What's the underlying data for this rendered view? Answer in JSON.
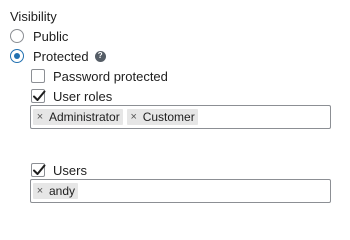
{
  "visibility": {
    "title": "Visibility",
    "options": [
      {
        "label": "Public",
        "selected": false
      },
      {
        "label": "Protected",
        "selected": true
      }
    ],
    "help_icon": "help-icon",
    "password_protected": {
      "label": "Password protected",
      "checked": false
    },
    "user_roles": {
      "label": "User roles",
      "checked": true,
      "tokens": [
        {
          "remove": "×",
          "label": "Administrator"
        },
        {
          "remove": "×",
          "label": "Customer"
        }
      ]
    },
    "users": {
      "label": "Users",
      "checked": true,
      "tokens": [
        {
          "remove": "×",
          "label": "andy"
        }
      ]
    },
    "help_glyph": "?"
  },
  "colors": {
    "accent": "#2271b1",
    "border": "#8c8f94",
    "token_bg": "#e6e6e6"
  }
}
